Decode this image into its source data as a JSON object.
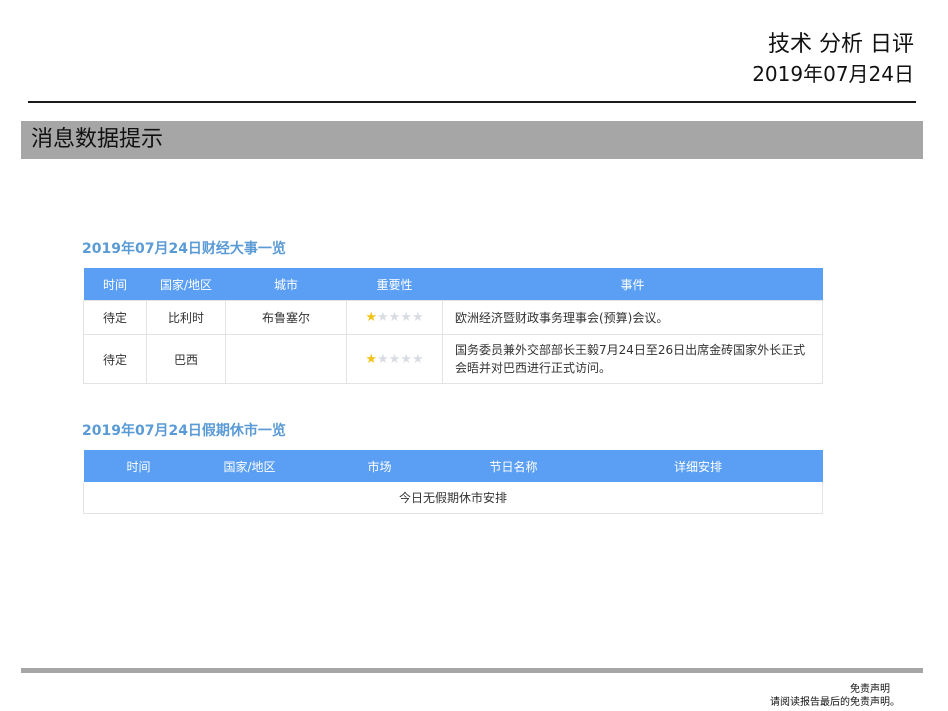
{
  "header": {
    "title": "技术 分析 日评",
    "date": "2019年07月24日"
  },
  "section": {
    "title": "消息数据提示"
  },
  "events": {
    "title": "2019年07月24日财经大事一览",
    "columns": [
      "时间",
      "国家/地区",
      "城市",
      "重要性",
      "事件"
    ],
    "rows": [
      {
        "time": "待定",
        "country": "比利时",
        "city": "布鲁塞尔",
        "importance": 1,
        "max": 5,
        "event": "欧洲经济暨财政事务理事会(预算)会议。"
      },
      {
        "time": "待定",
        "country": "巴西",
        "city": "",
        "importance": 1,
        "max": 5,
        "event": "国务委员兼外交部部长王毅7月24日至26日出席金砖国家外长正式会晤并对巴西进行正式访问。"
      }
    ]
  },
  "holidays": {
    "title": "2019年07月24日假期休市一览",
    "columns": [
      "时间",
      "国家/地区",
      "市场",
      "节日名称",
      "详细安排"
    ],
    "empty_text": "今日无假期休市安排"
  },
  "footer": {
    "disclaimer_title": "免责声明",
    "disclaimer_text": "请阅读报告最后的免责声明。"
  },
  "colors": {
    "accent": "#5b9ff5",
    "title_blue": "#5b9bd5",
    "bar_gray": "#a6a6a6",
    "star_on": "#f2c318",
    "star_off": "#d9dde3"
  }
}
